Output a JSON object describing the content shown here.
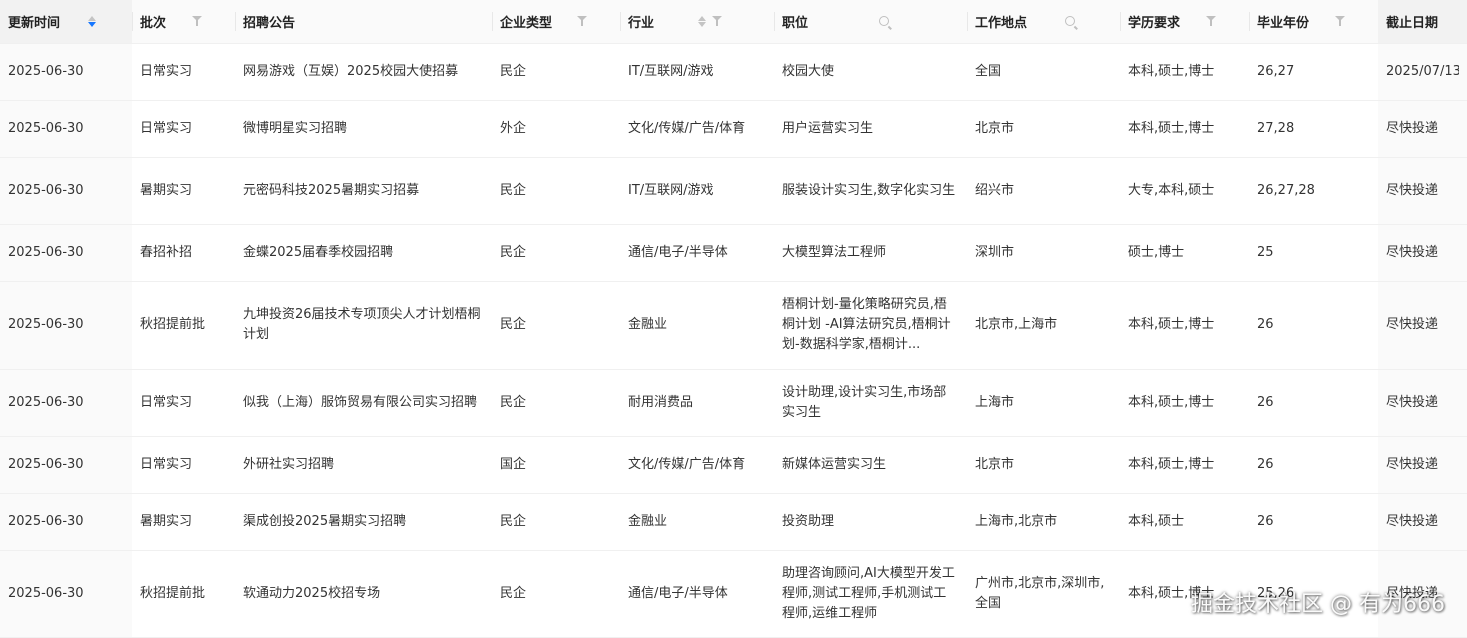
{
  "table": {
    "columns": [
      {
        "label": "更新时间",
        "sortable": true,
        "sort": "desc",
        "filter": false,
        "search": false
      },
      {
        "label": "批次",
        "sortable": false,
        "filter": true,
        "search": false
      },
      {
        "label": "招聘公告",
        "sortable": false,
        "filter": false,
        "search": false
      },
      {
        "label": "企业类型",
        "sortable": false,
        "filter": true,
        "search": false
      },
      {
        "label": "行业",
        "sortable": true,
        "filter": true,
        "search": false
      },
      {
        "label": "职位",
        "sortable": false,
        "filter": false,
        "search": true
      },
      {
        "label": "工作地点",
        "sortable": false,
        "filter": false,
        "search": true
      },
      {
        "label": "学历要求",
        "sortable": false,
        "filter": true,
        "search": false
      },
      {
        "label": "毕业年份",
        "sortable": false,
        "filter": true,
        "search": false
      },
      {
        "label": "截止日期",
        "sortable": false,
        "filter": false,
        "search": false
      }
    ],
    "rows": [
      {
        "cells": [
          "2025-06-30",
          "日常实习",
          "网易游戏（互娱）2025校园大使招募",
          "民企",
          "IT/互联网/游戏",
          "校园大使",
          "全国",
          "本科,硕士,博士",
          "26,27",
          "2025/07/13"
        ]
      },
      {
        "cells": [
          "2025-06-30",
          "日常实习",
          "微博明星实习招聘",
          "外企",
          "文化/传媒/广告/体育",
          "用户运营实习生",
          "北京市",
          "本科,硕士,博士",
          "27,28",
          "尽快投递"
        ]
      },
      {
        "cells": [
          "2025-06-30",
          "暑期实习",
          "元密码科技2025暑期实习招募",
          "民企",
          "IT/互联网/游戏",
          "服装设计实习生,数字化实习生",
          "绍兴市",
          "大专,本科,硕士",
          "26,27,28",
          "尽快投递"
        ]
      },
      {
        "cells": [
          "2025-06-30",
          "春招补招",
          "金蝶2025届春季校园招聘",
          "民企",
          "通信/电子/半导体",
          "大模型算法工程师",
          "深圳市",
          "硕士,博士",
          "25",
          "尽快投递"
        ]
      },
      {
        "cells": [
          "2025-06-30",
          "秋招提前批",
          "九坤投资26届技术专项顶尖人才计划梧桐计划",
          "民企",
          "金融业",
          "梧桐计划-量化策略研究员,梧桐计划 -AI算法研究员,梧桐计划-数据科学家,梧桐计...",
          "北京市,上海市",
          "本科,硕士,博士",
          "26",
          "尽快投递"
        ]
      },
      {
        "cells": [
          "2025-06-30",
          "日常实习",
          "似我（上海）服饰贸易有限公司实习招聘",
          "民企",
          "耐用消费品",
          "设计助理,设计实习生,市场部实习生",
          "上海市",
          "本科,硕士,博士",
          "26",
          "尽快投递"
        ]
      },
      {
        "cells": [
          "2025-06-30",
          "日常实习",
          "外研社实习招聘",
          "国企",
          "文化/传媒/广告/体育",
          "新媒体运营实习生",
          "北京市",
          "本科,硕士,博士",
          "26",
          "尽快投递"
        ]
      },
      {
        "cells": [
          "2025-06-30",
          "暑期实习",
          "渠成创投2025暑期实习招聘",
          "民企",
          "金融业",
          "投资助理",
          "上海市,北京市",
          "本科,硕士",
          "26",
          "尽快投递"
        ]
      },
      {
        "cells": [
          "2025-06-30",
          "秋招提前批",
          "软通动力2025校招专场",
          "民企",
          "通信/电子/半导体",
          "助理咨询顾问,AI大模型开发工程师,测试工程师,手机测试工程师,运维工程师",
          "广州市,北京市,深圳市,全国",
          "本科,硕士,博士",
          "25,26",
          "尽快投递"
        ]
      }
    ]
  },
  "watermark": "掘金技术社区 @ 有为666",
  "colors": {
    "accent": "#1677ff",
    "header_bg": "#fafafa",
    "frozen_bg": "#f2f2f2",
    "border": "#f0f0f0"
  }
}
